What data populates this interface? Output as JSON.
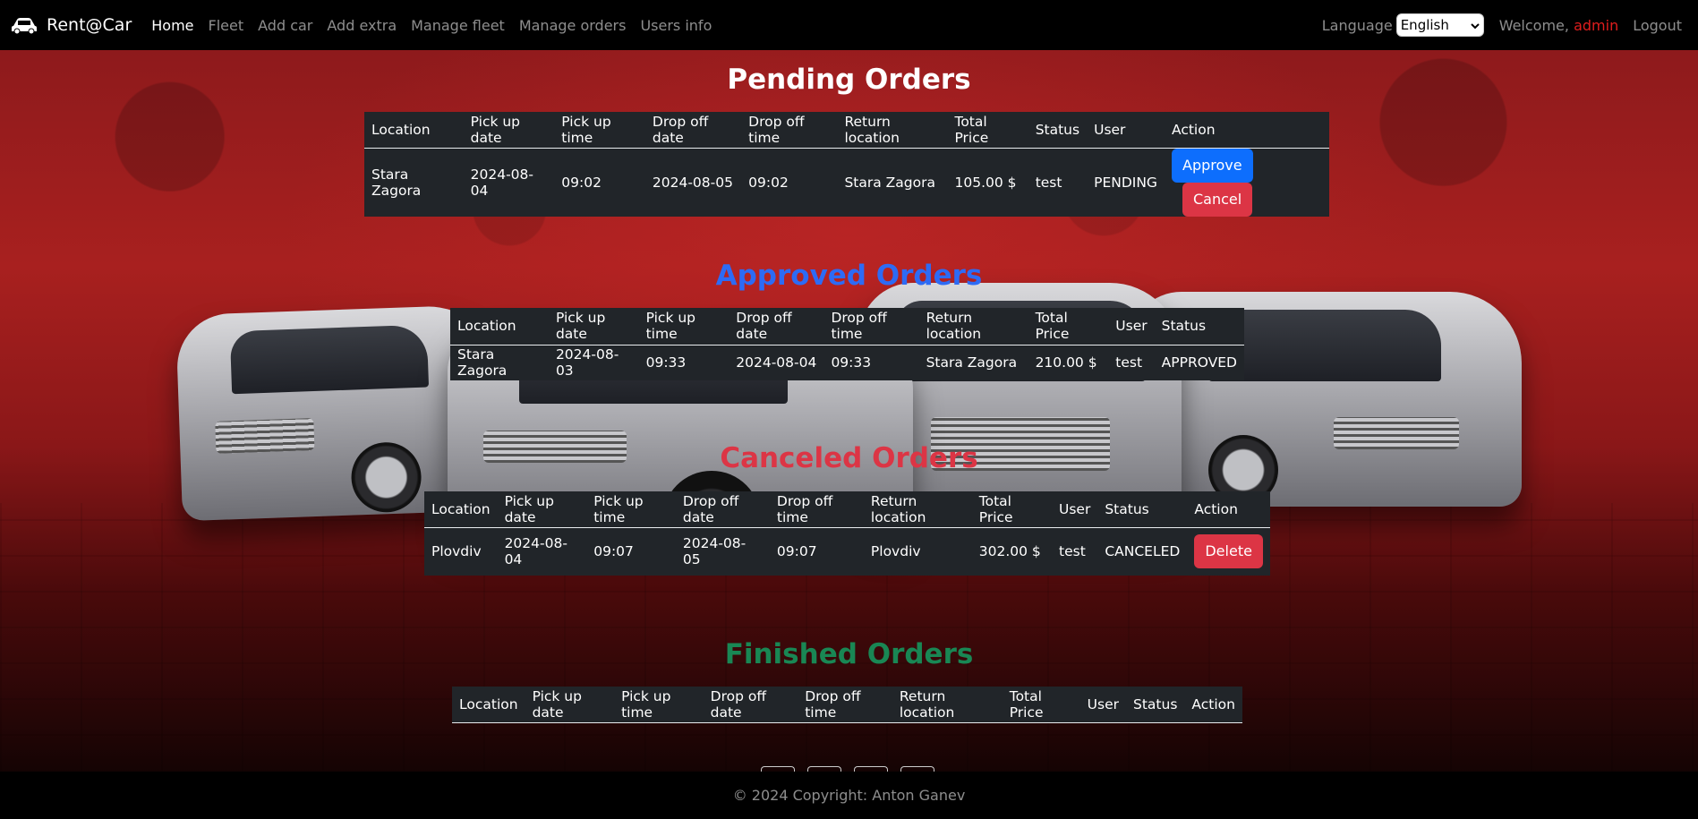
{
  "brand": {
    "name": "Rent@Car"
  },
  "nav": {
    "home": "Home",
    "fleet": "Fleet",
    "add_car": "Add car",
    "add_extra": "Add extra",
    "manage_fleet": "Manage fleet",
    "manage_orders": "Manage orders",
    "users_info": "Users info"
  },
  "header": {
    "language_label": "Language",
    "language_value": "English",
    "welcome": "Welcome,",
    "username": "admin",
    "logout": "Logout"
  },
  "columns": {
    "location": "Location",
    "pickup_date": "Pick up date",
    "pickup_time": "Pick up time",
    "dropoff_date": "Drop off date",
    "dropoff_time": "Drop off time",
    "return_location": "Return location",
    "total_price": "Total Price",
    "status": "Status",
    "user": "User",
    "action": "Action"
  },
  "pending": {
    "title": "Pending Orders",
    "row": {
      "location": "Stara Zagora",
      "pickup_date": "2024-08-04",
      "pickup_time": "09:02",
      "dropoff_date": "2024-08-05",
      "dropoff_time": "09:02",
      "return_location": "Stara Zagora",
      "total_price": "105.00 $",
      "status": "test",
      "user": "PENDING",
      "approve": "Approve",
      "cancel": "Cancel"
    }
  },
  "approved": {
    "title": "Approved Orders",
    "row": {
      "location": "Stara Zagora",
      "pickup_date": "2024-08-03",
      "pickup_time": "09:33",
      "dropoff_date": "2024-08-04",
      "dropoff_time": "09:33",
      "return_location": "Stara Zagora",
      "total_price": "210.00 $",
      "user": "test",
      "status": "APPROVED"
    }
  },
  "canceled": {
    "title": "Canceled Orders",
    "row": {
      "location": "Plovdiv",
      "pickup_date": "2024-08-04",
      "pickup_time": "09:07",
      "dropoff_date": "2024-08-05",
      "dropoff_time": "09:07",
      "return_location": "Plovdiv",
      "total_price": "302.00 $",
      "user": "test",
      "status": "CANCELED",
      "delete": "Delete"
    }
  },
  "finished": {
    "title": "Finished Orders"
  },
  "footer": {
    "copyright": "© 2024 Copyright: Anton Ganev"
  }
}
